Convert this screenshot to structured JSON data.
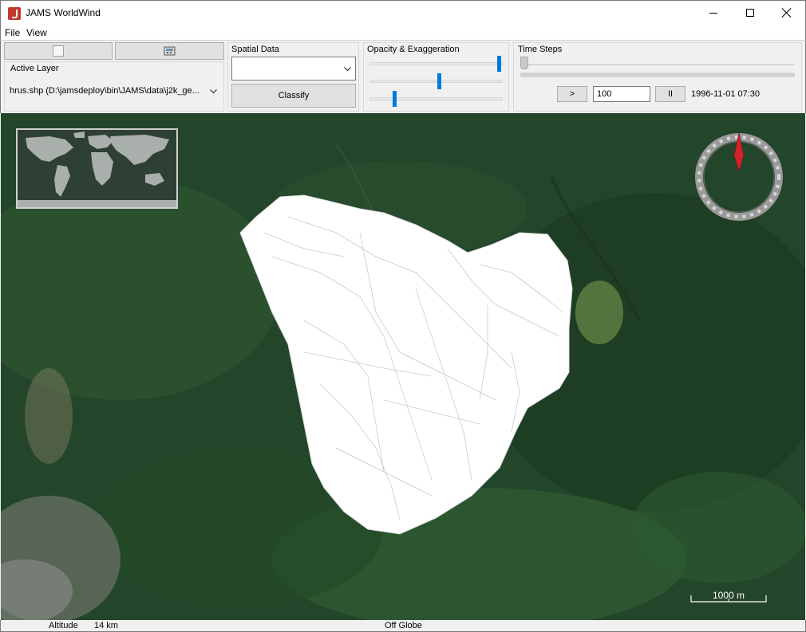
{
  "window": {
    "title": "JAMS WorldWind"
  },
  "menu": {
    "items": [
      "File",
      "View"
    ]
  },
  "active_layer": {
    "label": "Active Layer",
    "value": "hrus.shp (D:\\jamsdeploy\\bin\\JAMS\\data\\j2k_ge..."
  },
  "spatial_data": {
    "label": "Spatial Data",
    "selected": "",
    "classify_label": "Classify"
  },
  "opacity": {
    "label": "Opacity & Exaggeration",
    "slider1_fraction": 1.0,
    "slider2_fraction": 0.5,
    "slider3_fraction": 0.17
  },
  "time_steps": {
    "label": "Time Steps",
    "slider_fraction": 0.0,
    "play_label": ">",
    "step_value": "100",
    "pause_label": "II",
    "timestamp": "1996-11-01 07:30"
  },
  "map": {
    "scale_label": "1000 m",
    "compass_color": "#d0232a"
  },
  "status": {
    "altitude_label": "Altitude",
    "altitude_value": "14 km",
    "position_text": "Off Globe"
  },
  "colors": {
    "accent": "#007ad9",
    "polygon_fill": "#ffffff"
  }
}
